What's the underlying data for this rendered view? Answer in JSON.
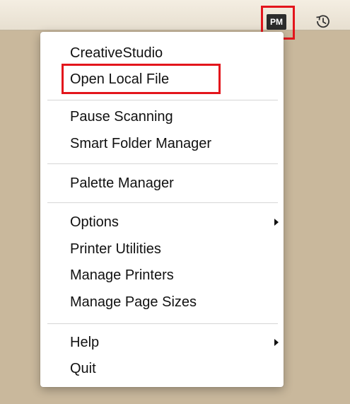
{
  "menubar": {
    "app_icon_text": "PM",
    "app_icon_name": "pm-app-icon",
    "history_icon_name": "history-icon"
  },
  "menu": {
    "groups": [
      [
        "CreativeStudio",
        "Open Local File"
      ],
      [
        "Pause Scanning",
        "Smart Folder Manager"
      ],
      [
        "Palette Manager"
      ],
      [
        "Options",
        "Printer Utilities",
        "Manage Printers",
        "Manage Page Sizes"
      ],
      [
        "Help",
        "Quit"
      ]
    ],
    "items": {
      "creativestudio": "CreativeStudio",
      "open_local_file": "Open Local File",
      "pause_scanning": "Pause Scanning",
      "smart_folder_manager": "Smart Folder Manager",
      "palette_manager": "Palette Manager",
      "options": "Options",
      "printer_utilities": "Printer Utilities",
      "manage_printers": "Manage Printers",
      "manage_page_sizes": "Manage Page Sizes",
      "help": "Help",
      "quit": "Quit"
    },
    "submenu_items": [
      "Options",
      "Help"
    ]
  },
  "colors": {
    "highlight": "#e3151c",
    "desktop": "#c9b89c",
    "menu_bg": "#ffffff"
  }
}
